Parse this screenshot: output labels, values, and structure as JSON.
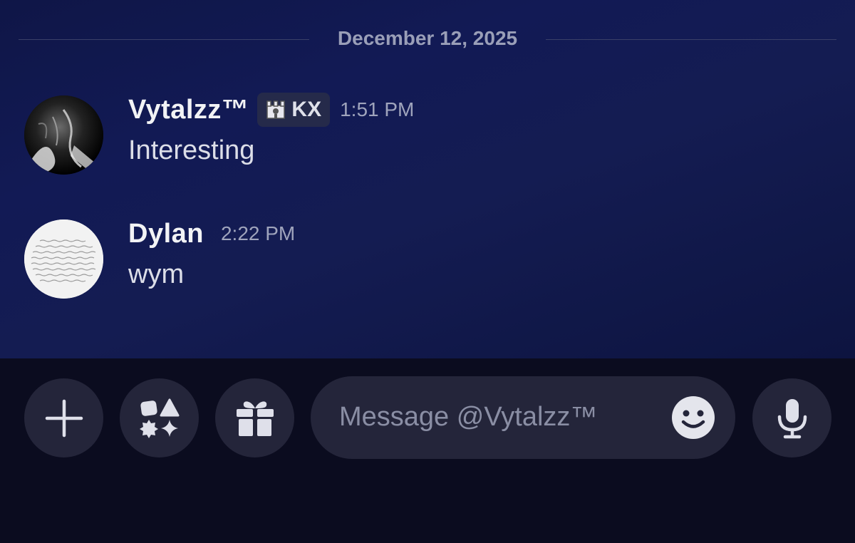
{
  "date_divider": "December 12, 2025",
  "messages": [
    {
      "username": "Vytalzz™",
      "tag": "KX",
      "timestamp": "1:51 PM",
      "text": "Interesting"
    },
    {
      "username": "Dylan",
      "timestamp": "2:22 PM",
      "text": "wym"
    }
  ],
  "composer": {
    "placeholder": "Message @Vytalzz™",
    "icons": [
      "plus-icon",
      "apps-icon",
      "gift-icon",
      "emoji-icon",
      "microphone-icon"
    ]
  },
  "colors": {
    "chat_background": "#121a55",
    "composer_background": "#0b0c1f",
    "button_background": "#24253a",
    "username": "#f2f3f5",
    "timestamp": "#9fa4bc"
  }
}
